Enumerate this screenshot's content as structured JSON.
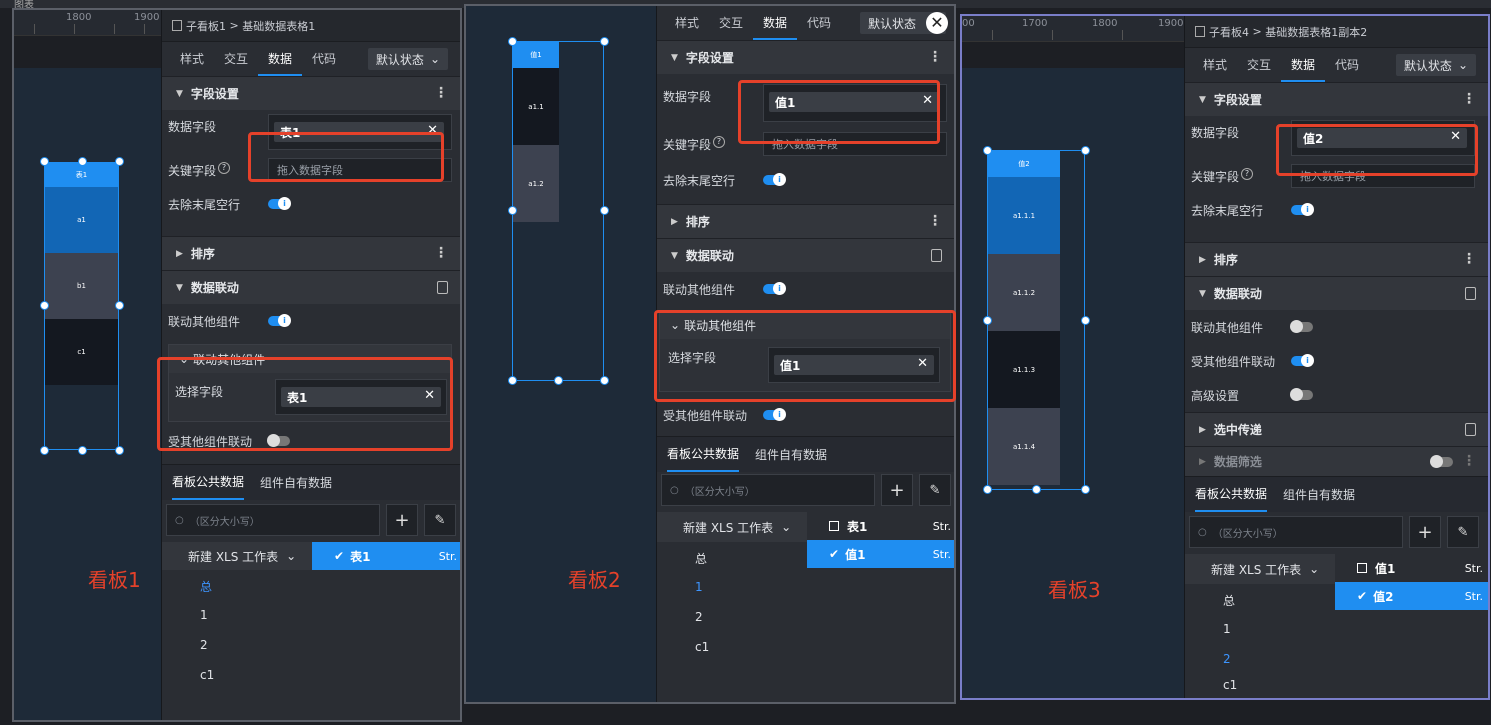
{
  "top_label": "图表",
  "board1": {
    "breadcrumb": {
      "parent": "子看板1",
      "sep": ">",
      "current": "基础数据表格1"
    },
    "tabs": [
      "样式",
      "交互",
      "数据",
      "代码"
    ],
    "state": "默认状态",
    "ruler": [
      "1800",
      "1900"
    ],
    "section_fields": "字段设置",
    "data_field_label": "数据字段",
    "data_field_value": "表1",
    "key_field_label": "关键字段",
    "key_field_placeholder": "拖入数据字段",
    "trim_label": "去除末尾空行",
    "section_sort": "排序",
    "section_link": "数据联动",
    "link_other_label": "联动其他组件",
    "sub_title": "联动其他组件",
    "select_field_label": "选择字段",
    "select_field_value": "表1",
    "received_label": "受其他组件联动",
    "data_tabs": [
      "看板公共数据",
      "组件自有数据"
    ],
    "search_placeholder": "（区分大小写）",
    "workbook": "新建 XLS 工作表",
    "tree": [
      "总",
      "1",
      "2",
      "c1"
    ],
    "fields": [
      {
        "name": "表1",
        "type": "Str."
      }
    ],
    "widget_cells": [
      "表1",
      "a1",
      "b1",
      "c1"
    ],
    "kanban_label": "看板1"
  },
  "board2": {
    "tabs": [
      "样式",
      "交互",
      "数据",
      "代码"
    ],
    "state": "默认状态",
    "section_fields": "字段设置",
    "data_field_label": "数据字段",
    "data_field_value": "值1",
    "key_field_label": "关键字段",
    "key_field_placeholder": "拖入数据字段",
    "trim_label": "去除末尾空行",
    "section_sort": "排序",
    "section_link": "数据联动",
    "link_other_label": "联动其他组件",
    "sub_title": "联动其他组件",
    "select_field_label": "选择字段",
    "select_field_value": "值1",
    "received_label": "受其他组件联动",
    "data_tabs": [
      "看板公共数据",
      "组件自有数据"
    ],
    "search_placeholder": "（区分大小写）",
    "workbook": "新建 XLS 工作表",
    "tree": [
      "总",
      "1",
      "2",
      "c1"
    ],
    "fields": [
      {
        "name": "表1",
        "type": "Str."
      },
      {
        "name": "值1",
        "type": "Str."
      }
    ],
    "widget_cells": [
      "值1",
      "a1.1",
      "a1.2"
    ],
    "kanban_label": "看板2"
  },
  "board3": {
    "breadcrumb": {
      "parent": "子看板4",
      "sep": ">",
      "current": "基础数据表格1副本2"
    },
    "tabs": [
      "样式",
      "交互",
      "数据",
      "代码"
    ],
    "state": "默认状态",
    "ruler": [
      "00",
      "1700",
      "1800",
      "1900"
    ],
    "section_fields": "字段设置",
    "data_field_label": "数据字段",
    "data_field_value": "值2",
    "key_field_label": "关键字段",
    "key_field_placeholder": "拖入数据字段",
    "trim_label": "去除末尾空行",
    "section_sort": "排序",
    "section_link": "数据联动",
    "link_other_label": "联动其他组件",
    "received_label": "受其他组件联动",
    "advanced_label": "高级设置",
    "section_select": "选中传递",
    "section_filter": "数据筛选",
    "data_tabs": [
      "看板公共数据",
      "组件自有数据"
    ],
    "search_placeholder": "（区分大小写）",
    "workbook": "新建 XLS 工作表",
    "tree": [
      "总",
      "1",
      "2",
      "c1"
    ],
    "fields": [
      {
        "name": "值1",
        "type": "Str."
      },
      {
        "name": "值2",
        "type": "Str."
      }
    ],
    "widget_cells": [
      "值2",
      "a1.1.1",
      "a1.1.2",
      "a1.1.3",
      "a1.1.4"
    ],
    "kanban_label": "看板3"
  }
}
